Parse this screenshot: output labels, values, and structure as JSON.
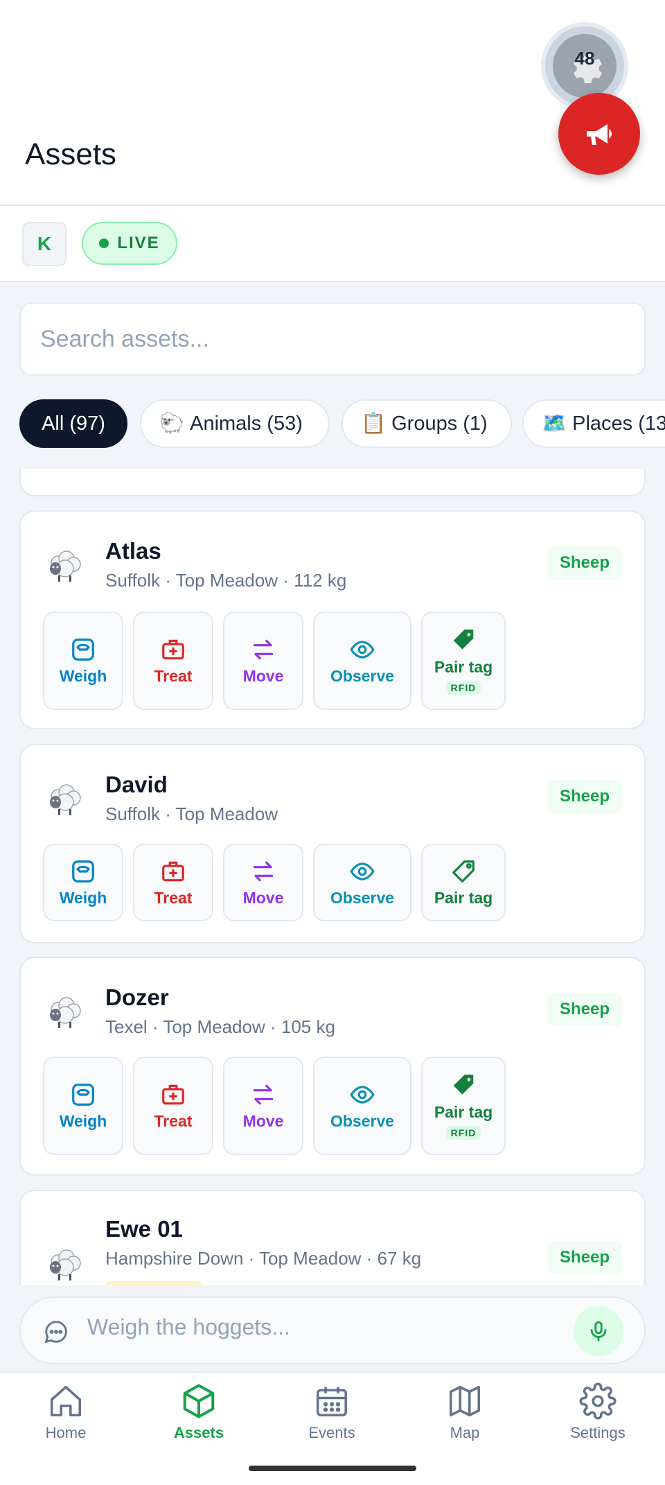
{
  "header": {
    "title": "Assets",
    "sync_count": "48"
  },
  "status": {
    "account_initial": "K",
    "live_label": "LIVE"
  },
  "search": {
    "placeholder": "Search assets..."
  },
  "filters": [
    {
      "label": "All (97)",
      "emoji": "",
      "active": true
    },
    {
      "label": "Animals (53)",
      "emoji": "🐑",
      "active": false
    },
    {
      "label": "Groups (1)",
      "emoji": "📋",
      "active": false
    },
    {
      "label": "Places (13",
      "emoji": "🗺️",
      "active": false
    }
  ],
  "actions": {
    "weigh": "Weigh",
    "treat": "Treat",
    "move": "Move",
    "observe": "Observe",
    "pair_tag": "Pair tag",
    "rfid": "RFID"
  },
  "assets": [
    {
      "name": "Atlas",
      "subtitle": "Suffolk · Top Meadow · 112 kg",
      "type": "Sheep",
      "rfid": true
    },
    {
      "name": "David",
      "subtitle": "Suffolk · Top Meadow",
      "type": "Sheep",
      "rfid": false
    },
    {
      "name": "Dozer",
      "subtitle": "Texel · Top Meadow · 105 kg",
      "type": "Sheep",
      "rfid": true
    },
    {
      "name": "Ewe 01",
      "subtitle": "Hampshire Down · Top Meadow · 67 kg",
      "type": "Sheep",
      "rfid": false
    }
  ],
  "chat": {
    "placeholder": "Weigh the hoggets..."
  },
  "nav": {
    "home": "Home",
    "assets": "Assets",
    "events": "Events",
    "map": "Map",
    "settings": "Settings"
  },
  "colors": {
    "accent": "#16a34a",
    "alert": "#dc2626",
    "weigh": "#0284c7",
    "treat": "#dc2626",
    "move": "#9333ea",
    "observe": "#0891b2"
  }
}
